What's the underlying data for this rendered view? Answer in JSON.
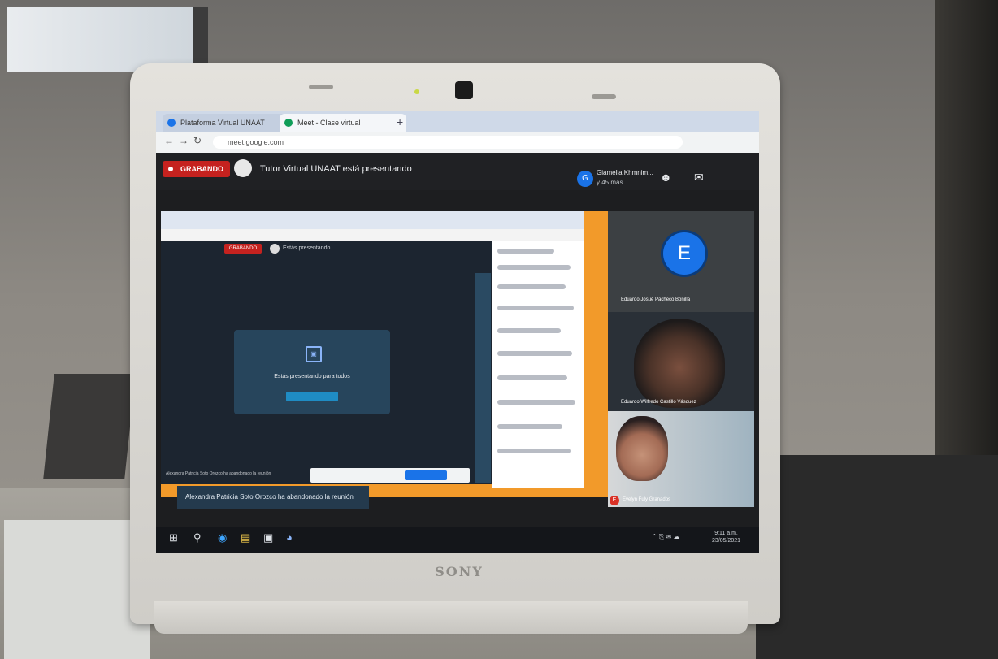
{
  "browser": {
    "tabs": [
      {
        "label": "Plataforma Virtual UNAAT",
        "color": "#1a73e8"
      },
      {
        "label": "Meet - Clase virtual",
        "color": "#0f9d58"
      }
    ],
    "new_tab": "+",
    "url": "meet.google.com"
  },
  "meet": {
    "recording_label": "GRABANDO",
    "presenter_text": "Tutor Virtual UNAAT está presentando",
    "attendee_initial": "G",
    "attendee_name": "Giamella Khmnim...",
    "attendee_more": "y 45 más",
    "people_icon": "people-icon",
    "chat_icon": "chat-icon"
  },
  "shared_screen": {
    "inner_recording_label": "GRABANDO",
    "inner_present_text": "Estás presentando",
    "present_card_title": "Estás presentando para todos",
    "inner_notice": "Alexandra Patricia Soto Orozco ha abandonado la reunión"
  },
  "participants": [
    {
      "initial": "E",
      "name": "Eduardo Josué Pacheco Bonilla",
      "avatar_color": "#1a73e8"
    },
    {
      "name": "Eduardo Wilfredo Castillo Vásquez"
    },
    {
      "initial": "E",
      "name": "Evelyn Fuly Granados"
    }
  ],
  "toast": {
    "text": "Alexandra Patricia Soto Orozco ha abandonado la reunión"
  },
  "laptop": {
    "brand": "SONY"
  },
  "taskbar": {
    "icons": [
      "windows-icon",
      "search-icon",
      "edge-icon",
      "file-explorer-icon",
      "store-icon",
      "chrome-icon"
    ],
    "clock_time": "9:11 a.m.",
    "clock_date": "23/05/2021"
  }
}
